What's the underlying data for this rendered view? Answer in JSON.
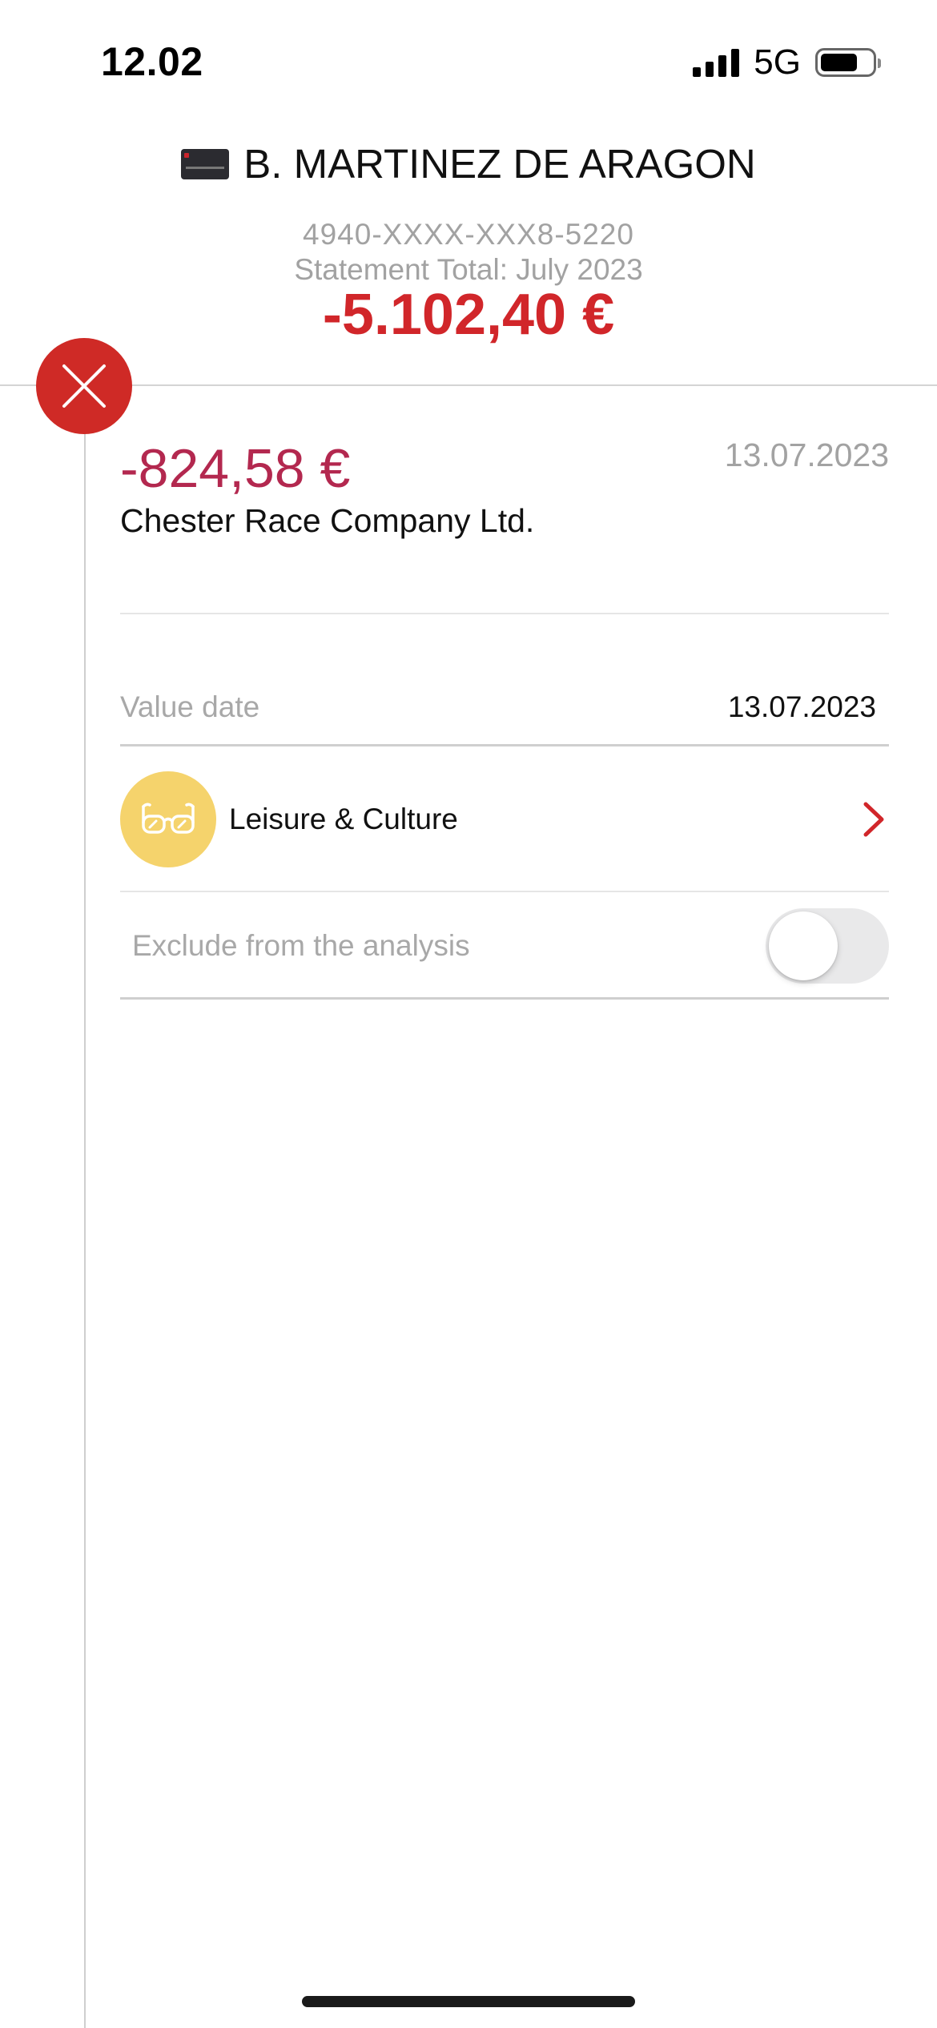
{
  "status_bar": {
    "time": "12.02",
    "network": "5G",
    "signal_bars": 4,
    "battery_level": 0.7
  },
  "header": {
    "holder_name": "B. MARTINEZ DE ARAGON",
    "card_icon": "credit-card-icon",
    "card_number": "4940-XXXX-XXX8-5220",
    "statement_label": "Statement Total: July 2023",
    "statement_total": "-5.102,40 €"
  },
  "close_button": {
    "icon": "close-icon",
    "color": "#cf2a26"
  },
  "transaction": {
    "amount": "-824,58 €",
    "date": "13.07.2023",
    "merchant": "Chester Race Company Ltd.",
    "value_date_label": "Value date",
    "value_date": "13.07.2023",
    "category": {
      "icon": "glasses-icon",
      "label": "Leisure & Culture",
      "color": "#f5d36c"
    },
    "exclude": {
      "label": "Exclude from the analysis",
      "enabled": false
    }
  },
  "colors": {
    "accent": "#d1262a",
    "amount": "#b3284f"
  }
}
